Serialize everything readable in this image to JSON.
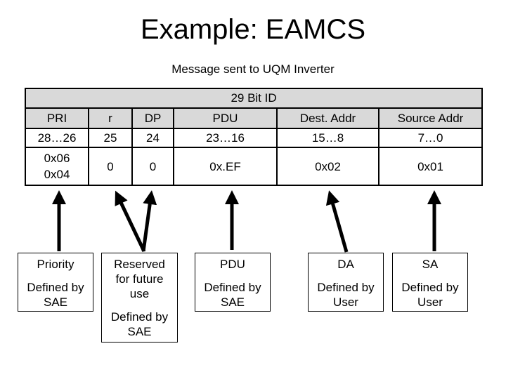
{
  "title": "Example: EAMCS",
  "subtitle": "Message sent to UQM Inverter",
  "table": {
    "header": "29 Bit ID",
    "columns": [
      {
        "name": "PRI",
        "bits": "28…26",
        "value_lines": [
          "0x06",
          "0x04"
        ]
      },
      {
        "name": "r",
        "bits": "25",
        "value_lines": [
          "0"
        ]
      },
      {
        "name": "DP",
        "bits": "24",
        "value_lines": [
          "0"
        ]
      },
      {
        "name": "PDU",
        "bits": "23…16",
        "value_lines": [
          "0x.EF"
        ]
      },
      {
        "name": "Dest. Addr",
        "bits": "15…8",
        "value_lines": [
          "0x02"
        ]
      },
      {
        "name": "Source Addr",
        "bits": "7…0",
        "value_lines": [
          "0x01"
        ]
      }
    ]
  },
  "boxes": [
    {
      "id": "priority",
      "title": "Priority",
      "extra": "",
      "desc": "Defined by SAE"
    },
    {
      "id": "reserved",
      "title": "Reserved for future use",
      "extra": "",
      "desc": "Defined by SAE"
    },
    {
      "id": "pdu",
      "title": "PDU",
      "extra": "",
      "desc": "Defined by SAE"
    },
    {
      "id": "da",
      "title": "DA",
      "extra": "",
      "desc": "Defined by User"
    },
    {
      "id": "sa",
      "title": "SA",
      "extra": "",
      "desc": "Defined by User"
    }
  ],
  "colors": {
    "header_fill": "#d9d9d9",
    "line": "#000000",
    "background": "#ffffff"
  }
}
